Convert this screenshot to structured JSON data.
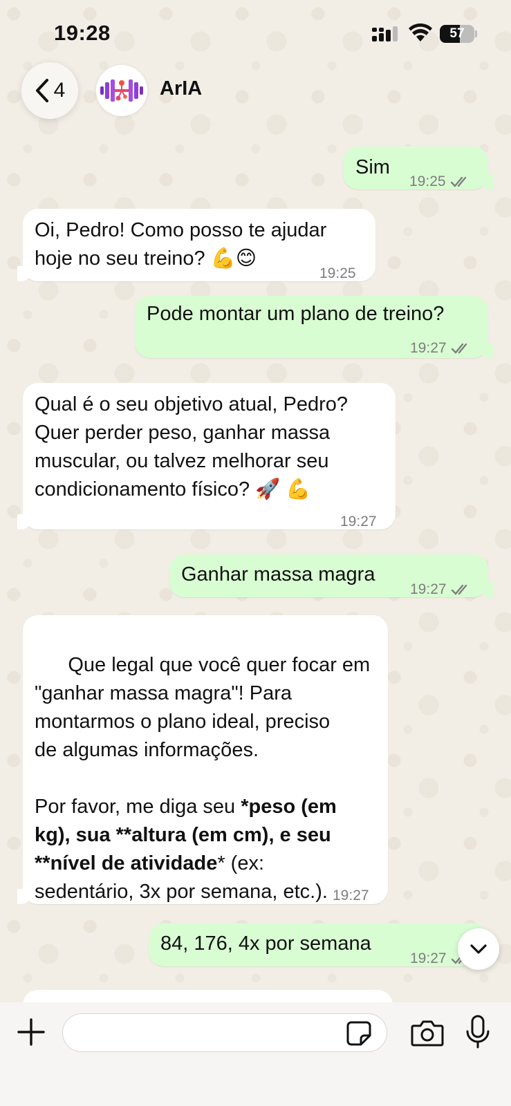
{
  "status_bar": {
    "time": "19:28",
    "battery": "57",
    "battery_level_percent": 57
  },
  "header": {
    "back_count": "4",
    "contact_name": "ArIA",
    "avatar_icon": "dumbbell-logo-icon"
  },
  "messages": [
    {
      "direction": "out",
      "text": "Sim",
      "time": "19:25",
      "status": "read"
    },
    {
      "direction": "in",
      "text": "Oi, Pedro! Como posso te ajudar\nhoje no seu treino? 💪😊",
      "time": "19:25"
    },
    {
      "direction": "out",
      "text": "Pode montar um plano de treino?",
      "time": "19:27",
      "status": "read"
    },
    {
      "direction": "in",
      "text": "Qual é o seu objetivo atual, Pedro?\nQuer perder peso, ganhar massa\nmuscular, ou talvez melhorar seu\ncondicionamento físico? 🚀 💪",
      "time": "19:27"
    },
    {
      "direction": "out",
      "text": "Ganhar massa magra",
      "time": "19:27",
      "status": "read"
    },
    {
      "direction": "in",
      "text_part1": "Que legal que você quer focar em\n\"ganhar massa magra\"! Para\nmontarmos o plano ideal, preciso\nde algumas informações.",
      "text_part2_prefix": "Por favor, me diga seu ",
      "text_part2_bold1": "*peso (em\nkg), sua **altura (em cm), e seu\n**nível de atividade",
      "text_part2_suffix": "* (ex:\nsedentário, 3x por semana, etc.).",
      "time": "19:27"
    },
    {
      "direction": "out",
      "text": "84, 176, 4x por semana",
      "time": "19:27",
      "status": "read"
    }
  ],
  "input_bar": {
    "placeholder": "",
    "icons": [
      "plus-icon",
      "sticker-icon",
      "camera-icon",
      "microphone-icon"
    ]
  },
  "colors": {
    "outgoing_bubble": "#d9fdd3",
    "incoming_bubble": "#ffffff",
    "background": "#f2ede5",
    "read_check": "#7d7d7d"
  }
}
